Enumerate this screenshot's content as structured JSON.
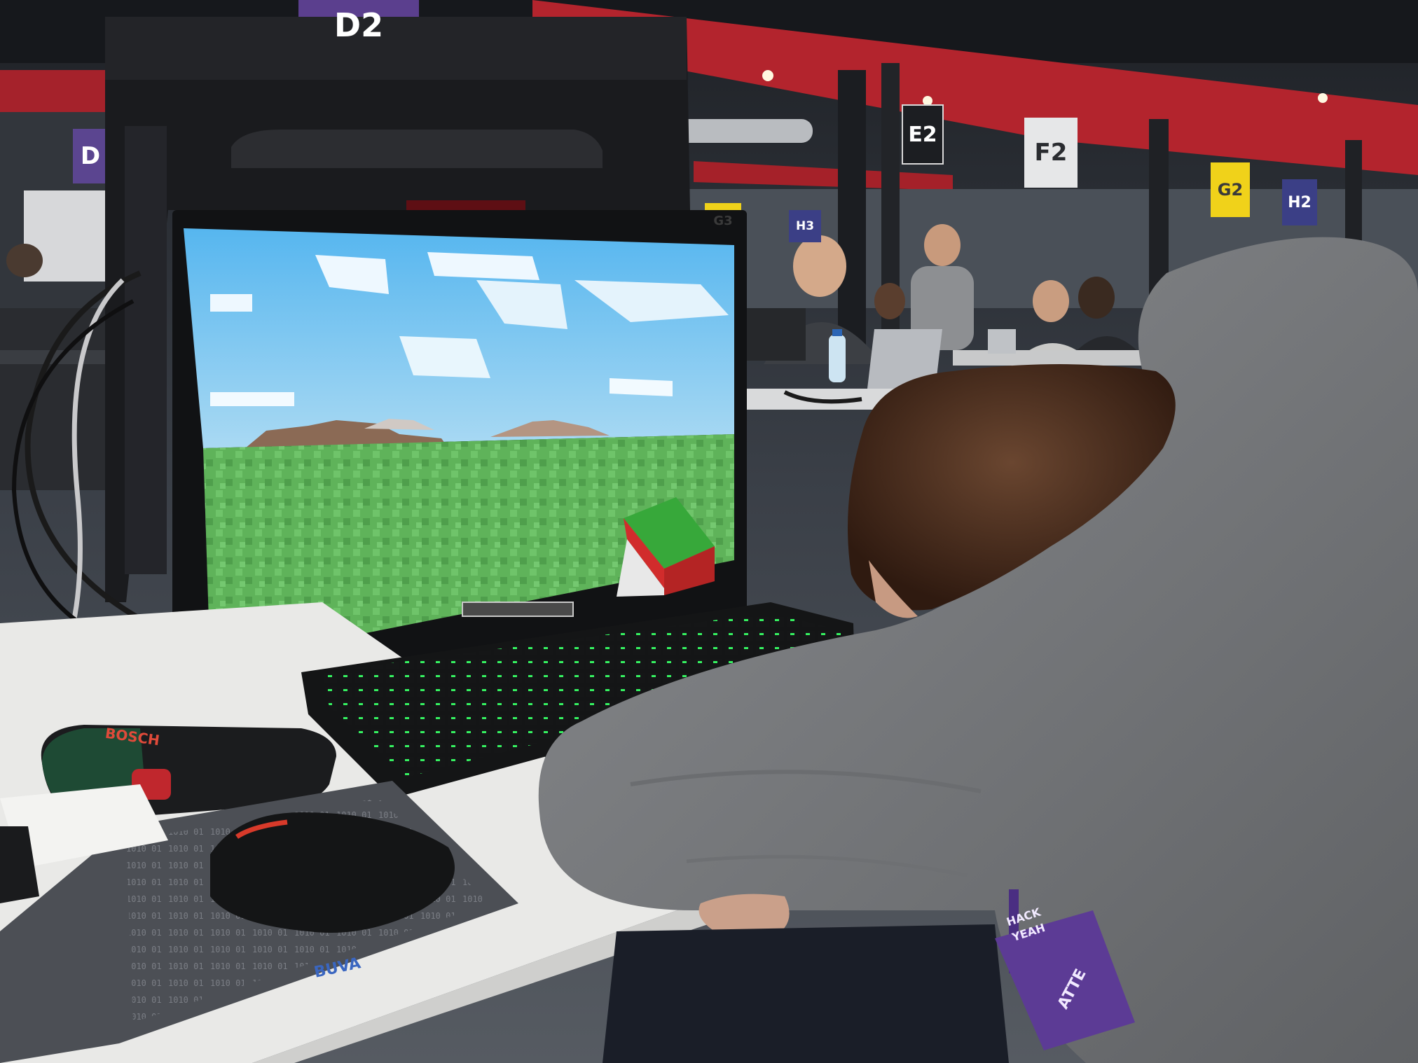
{
  "scene": {
    "description_tag": "photo",
    "colors": {
      "ceiling_red": "#b8272f",
      "sky": "#7fc6ee",
      "grass": "#5fb75c",
      "hoodie": "#7b7d80",
      "hair": "#4a2c1d",
      "keyboard_glow": "#3dff6a",
      "desk": "#e9e9e7",
      "purple_sign": "#5b3f8e",
      "yellow_sign": "#f0d21a",
      "navy_sign": "#3b3f86"
    }
  },
  "signs": {
    "d2": "D2",
    "e2": "E2",
    "f2": "F2",
    "g2": "G2",
    "h2": "H2",
    "g3": "G3",
    "h3": "H3",
    "d_left": "D"
  },
  "mousepad": {
    "brand": "BUVA"
  },
  "screwdriver": {
    "brand": "BOSCH"
  },
  "lanyard": {
    "line1": "HACK",
    "line2": "YEAH",
    "badge": "ATTE"
  }
}
